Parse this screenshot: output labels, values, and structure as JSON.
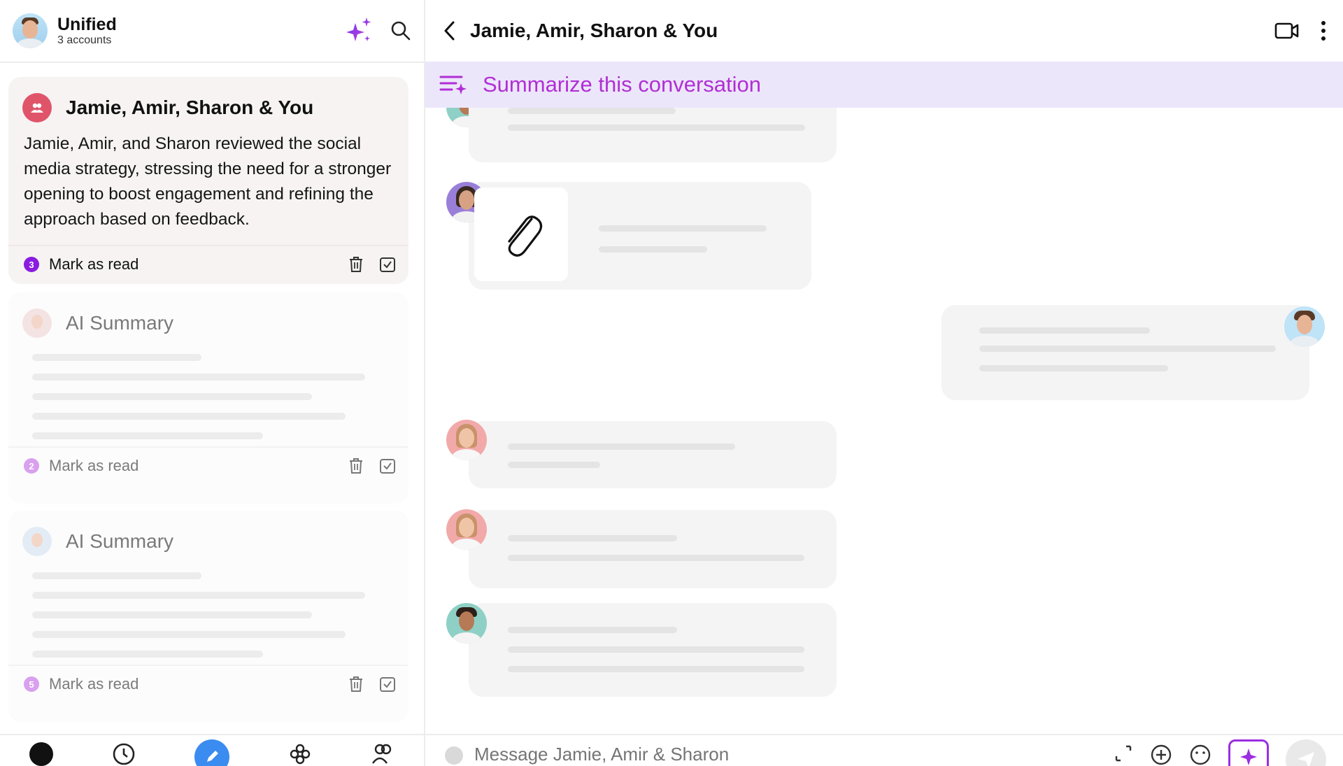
{
  "account": {
    "title": "Unified",
    "subtitle": "3 accounts"
  },
  "conversations": [
    {
      "title": "Jamie, Amir, Sharon & You",
      "summary": "Jamie, Amir, and Sharon reviewed the social media strategy, stressing the need for a stronger opening to boost engagement and refining the approach based on feedback.",
      "badge": "3",
      "badge_color": "#8a1be0",
      "mark_label": "Mark as read"
    },
    {
      "title": "AI Summary",
      "badge": "2",
      "badge_color": "#d8a0ef",
      "mark_label": "Mark as read"
    },
    {
      "title": "AI Summary",
      "badge": "5",
      "badge_color": "#d8a0ef",
      "mark_label": "Mark as read"
    }
  ],
  "chat": {
    "title": "Jamie, Amir, Sharon & You",
    "summarize_label": "Summarize this conversation",
    "input_placeholder": "Message Jamie, Amir & Sharon"
  },
  "colors": {
    "accent_purple": "#b02fd4",
    "summary_bar_bg": "#ece6fb",
    "compose_blue": "#3b8cf0",
    "group_avatar": "#e0546a"
  },
  "icons": {
    "header": [
      "sparkles-icon",
      "search-icon"
    ],
    "chat_header": [
      "back-chevron-icon",
      "video-camera-icon",
      "more-vertical-icon"
    ],
    "card_actions": [
      "trash-icon",
      "checkbox-icon"
    ],
    "bottom_nav": [
      "home-dot-icon",
      "clock-icon",
      "compose-pencil-icon",
      "flower-icon",
      "contacts-icon"
    ],
    "composer": [
      "expand-icon",
      "add-circle-icon",
      "emoji-icon",
      "ai-sparkle-icon",
      "send-icon"
    ]
  }
}
